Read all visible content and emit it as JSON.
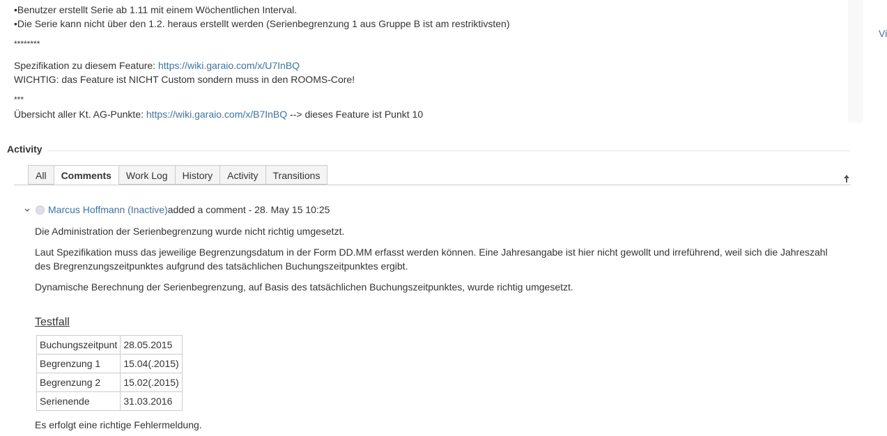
{
  "description": {
    "line1": "•Benutzer erstellt Serie ab 1.11 mit einem Wöchentlichen Interval.",
    "line2": "•Die Serie kann nicht über den 1.2. heraus erstellt werden (Serienbegrenzung 1 aus Gruppe B ist am restriktivsten)",
    "sep1": "********",
    "spec_prefix": "Spezifikation zu diesem Feature: ",
    "spec_link": "https://wiki.garaio.com/x/U7InBQ",
    "wichtig": "WICHTIG: das Feature ist NICHT Custom sondern muss in den ROOMS-Core!",
    "sep2": "***",
    "overview_prefix": "Übersicht aller Kt. AG-Punkte: ",
    "overview_link": "https://wiki.garaio.com/x/B7InBQ",
    "overview_suffix": " --> dieses Feature ist Punkt 10"
  },
  "side_link": "Vi",
  "activity": {
    "title": "Activity",
    "tabs": [
      "All",
      "Comments",
      "Work Log",
      "History",
      "Activity",
      "Transitions"
    ],
    "active_tab": "Comments"
  },
  "comment": {
    "author": "Marcus Hoffmann (Inactive)",
    "action": " added a comment - 28. May 15 10:25",
    "p1": "Die Administration der Serienbegrenzung wurde nicht richtig umgesetzt.",
    "p2a": "Laut Spezifikation muss das jeweilige Begrenzungsdatum in der Form DD.MM erfasst werden können. Eine Jahresangabe ist hier nicht gewollt und irreführend, weil sich die Jahreszahl",
    "p2b": "des Bregrenzungszeitpunktes aufgrund des tatsächlichen Buchungszeitpunktes ergibt.",
    "p3": "Dynamische Berechnung der Serienbegrenzung, auf Basis des tatsächlichen Buchungszeitpunktes, wurde richtig umgesetzt.",
    "testfall_title": "Testfall",
    "table": [
      [
        "Buchungszeitpunt",
        "28.05.2015"
      ],
      [
        "Begrenzung 1",
        "15.04(.2015)"
      ],
      [
        "Begrenzung 2",
        "15.02(.2015)"
      ],
      [
        "Serienende",
        "31.03.2016"
      ]
    ],
    "p4": "Es erfolgt eine richtige Fehlermeldung."
  }
}
